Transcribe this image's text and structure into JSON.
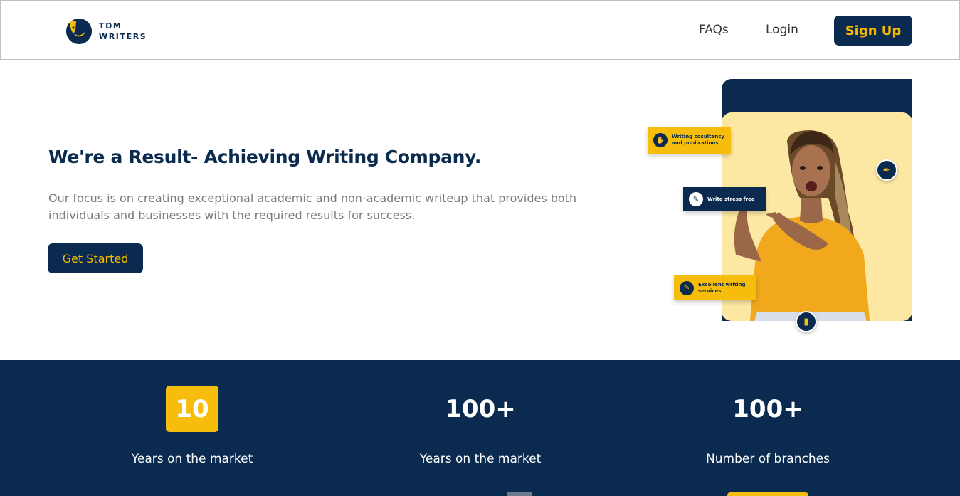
{
  "header": {
    "logo_line1": "TDM",
    "logo_line2": "WRITERS",
    "logo_icon": "pen-nib-icon",
    "nav": {
      "faqs": "FAQs",
      "login": "Login"
    },
    "signup_label": "Sign Up"
  },
  "hero": {
    "title": "We're a Result- Achieving Writing Company.",
    "description": "Our focus is on creating exceptional academic and non-academic writeup that provides both individuals and businesses with the required results for success.",
    "cta_label": "Get Started",
    "tags": [
      {
        "label": "Writing cosultancy and publications",
        "icon": "handshake-icon"
      },
      {
        "label": "Write stress free",
        "icon": "pen-icon"
      },
      {
        "label": "Excellent writing services",
        "icon": "pen-icon"
      }
    ]
  },
  "stats": [
    {
      "value": "10",
      "label": "Years on the market"
    },
    {
      "value": "100+",
      "label": "Years on the market"
    },
    {
      "value": "100+",
      "label": "Number of branches"
    }
  ],
  "colors": {
    "navy": "#0a2b4f",
    "accent_yellow": "#f6bd0c",
    "light_yellow": "#fde8a3",
    "muted_text": "#7a7a7a"
  }
}
